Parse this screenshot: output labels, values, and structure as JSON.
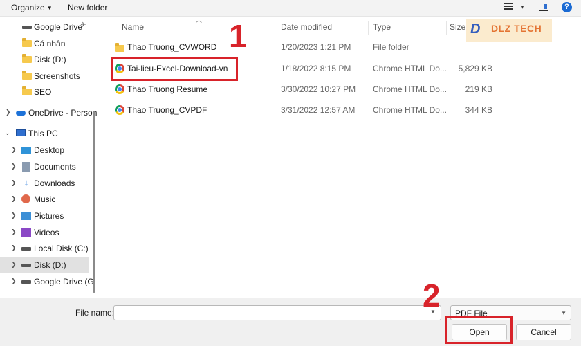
{
  "toolbar": {
    "organize": "Organize",
    "new_folder": "New folder"
  },
  "nav": {
    "items": [
      {
        "label": "Google Drive",
        "icon": "drive-icon"
      },
      {
        "label": "Cá nhân",
        "icon": "folder-icon"
      },
      {
        "label": "Disk (D:)",
        "icon": "folder-icon"
      },
      {
        "label": "Screenshots",
        "icon": "folder-icon"
      },
      {
        "label": "SEO",
        "icon": "folder-icon"
      },
      {
        "label": "OneDrive - Person",
        "icon": "cloud-icon"
      },
      {
        "label": "This PC",
        "icon": "computer-icon"
      },
      {
        "label": "Desktop",
        "icon": "desktop-icon"
      },
      {
        "label": "Documents",
        "icon": "documents-icon"
      },
      {
        "label": "Downloads",
        "icon": "download-icon"
      },
      {
        "label": "Music",
        "icon": "music-icon"
      },
      {
        "label": "Pictures",
        "icon": "pictures-icon"
      },
      {
        "label": "Videos",
        "icon": "videos-icon"
      },
      {
        "label": "Local Disk (C:)",
        "icon": "drive-icon"
      },
      {
        "label": "Disk (D:)",
        "icon": "drive-icon"
      },
      {
        "label": "Google Drive (G",
        "icon": "drive-icon"
      }
    ],
    "selected": "Disk (D:)"
  },
  "columns": {
    "name": "Name",
    "date": "Date modified",
    "type": "Type",
    "size": "Size"
  },
  "files": [
    {
      "name": "Thao Truong_CVWORD",
      "date": "1/20/2023 1:21 PM",
      "type": "File folder",
      "size": "",
      "icon": "folder-icon"
    },
    {
      "name": "Tai-lieu-Excel-Download-vn",
      "date": "1/18/2022 8:15 PM",
      "type": "Chrome HTML Do...",
      "size": "5,829 KB",
      "icon": "chrome-icon"
    },
    {
      "name": "Thao Truong Resume",
      "date": "3/30/2022 10:27 PM",
      "type": "Chrome HTML Do...",
      "size": "219 KB",
      "icon": "chrome-icon"
    },
    {
      "name": "Thao Truong_CVPDF",
      "date": "3/31/2022 12:57 AM",
      "type": "Chrome HTML Do...",
      "size": "344 KB",
      "icon": "chrome-icon"
    }
  ],
  "annotations": {
    "step1": "1",
    "step2": "2"
  },
  "watermark": {
    "logo": "D",
    "text": "DLZ TECH"
  },
  "bottom": {
    "file_name_label": "File name:",
    "file_name_value": "",
    "file_type": "PDF File",
    "open": "Open",
    "cancel": "Cancel"
  },
  "colors": {
    "highlight": "#d8232a",
    "accent": "#1a6ad3"
  }
}
